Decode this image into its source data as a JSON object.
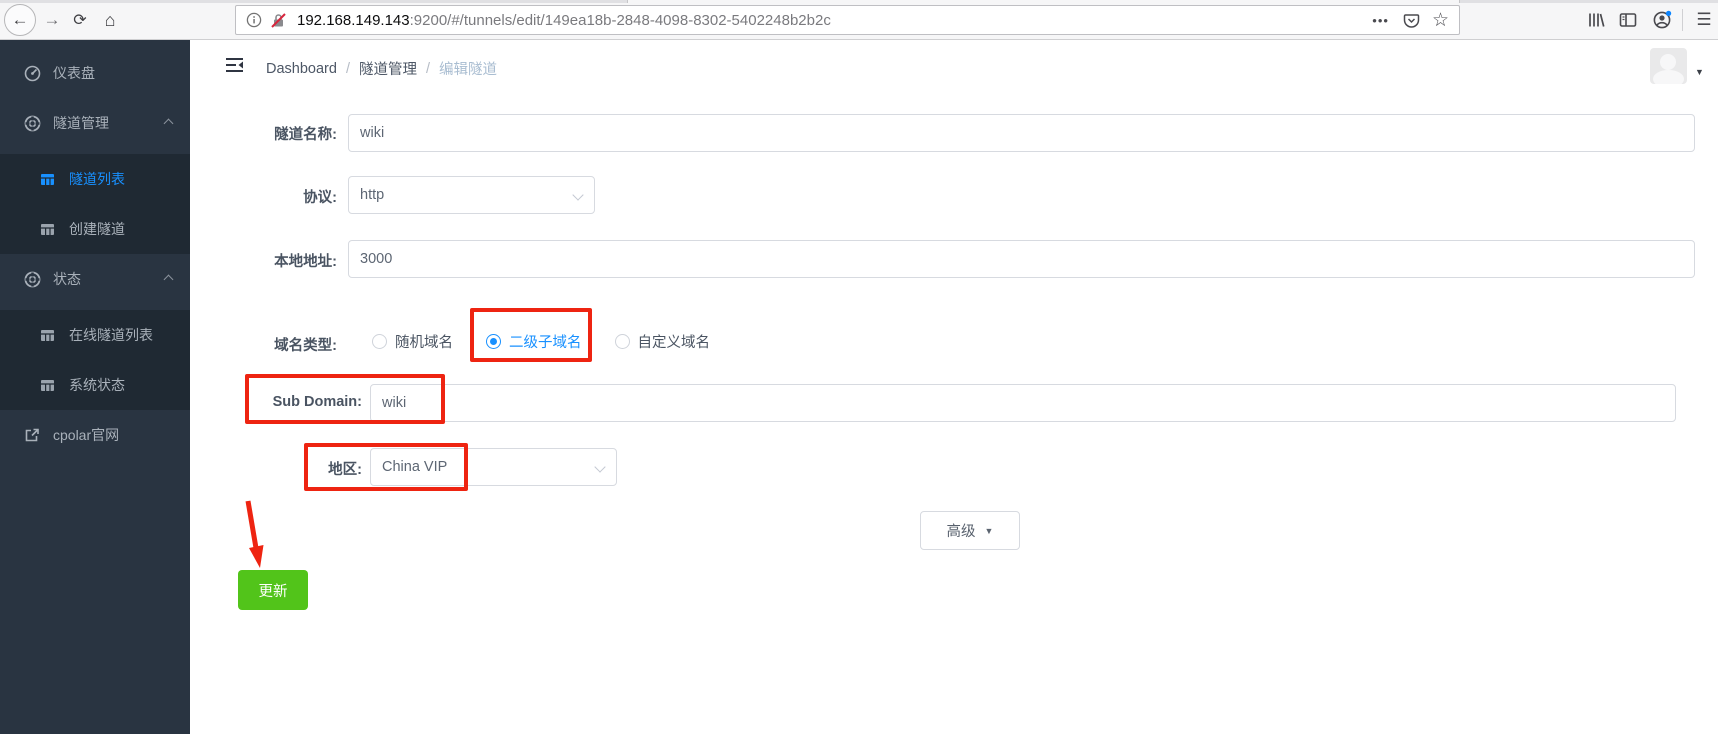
{
  "browser": {
    "url_host": "192.168.149.143",
    "url_path": ":9200/#/tunnels/edit/149ea18b-2848-4098-8302-5402248b2b2c"
  },
  "icons": {
    "back": "←",
    "forward": "→",
    "reload": "⟳",
    "home": "⌂",
    "page_actions": "•••",
    "star": "☆",
    "menu": "☰",
    "caret_down": "▼"
  },
  "sidebar": {
    "items": [
      {
        "label": "仪表盘"
      },
      {
        "label": "隧道管理",
        "children": [
          {
            "label": "隧道列表",
            "active": true
          },
          {
            "label": "创建隧道",
            "active": false
          }
        ]
      },
      {
        "label": "状态",
        "children": [
          {
            "label": "在线隧道列表",
            "active": false
          },
          {
            "label": "系统状态",
            "active": false
          }
        ]
      },
      {
        "label": "cpolar官网"
      }
    ]
  },
  "header": {
    "breadcrumb": [
      "Dashboard",
      "隧道管理",
      "编辑隧道"
    ],
    "separator": "/"
  },
  "form": {
    "tunnel_name": {
      "label": "隧道名称:",
      "value": "wiki"
    },
    "protocol": {
      "label": "协议:",
      "value": "http"
    },
    "local_address": {
      "label": "本地地址:",
      "value": "3000"
    },
    "domain_type": {
      "label": "域名类型:",
      "options": [
        {
          "label": "随机域名",
          "selected": false
        },
        {
          "label": "二级子域名",
          "selected": true
        },
        {
          "label": "自定义域名",
          "selected": false
        }
      ]
    },
    "sub_domain": {
      "label": "Sub Domain:",
      "value": "wiki"
    },
    "region": {
      "label": "地区:",
      "value": "China VIP"
    },
    "advanced": {
      "label": "高级"
    },
    "update": {
      "label": "更新"
    }
  },
  "colors": {
    "accent_blue": "#1890ff",
    "button_green": "#52c41a",
    "annotation_red": "#ee2411",
    "sidebar_bg": "#293441",
    "sidebar_submenu_bg": "#1f2933"
  }
}
